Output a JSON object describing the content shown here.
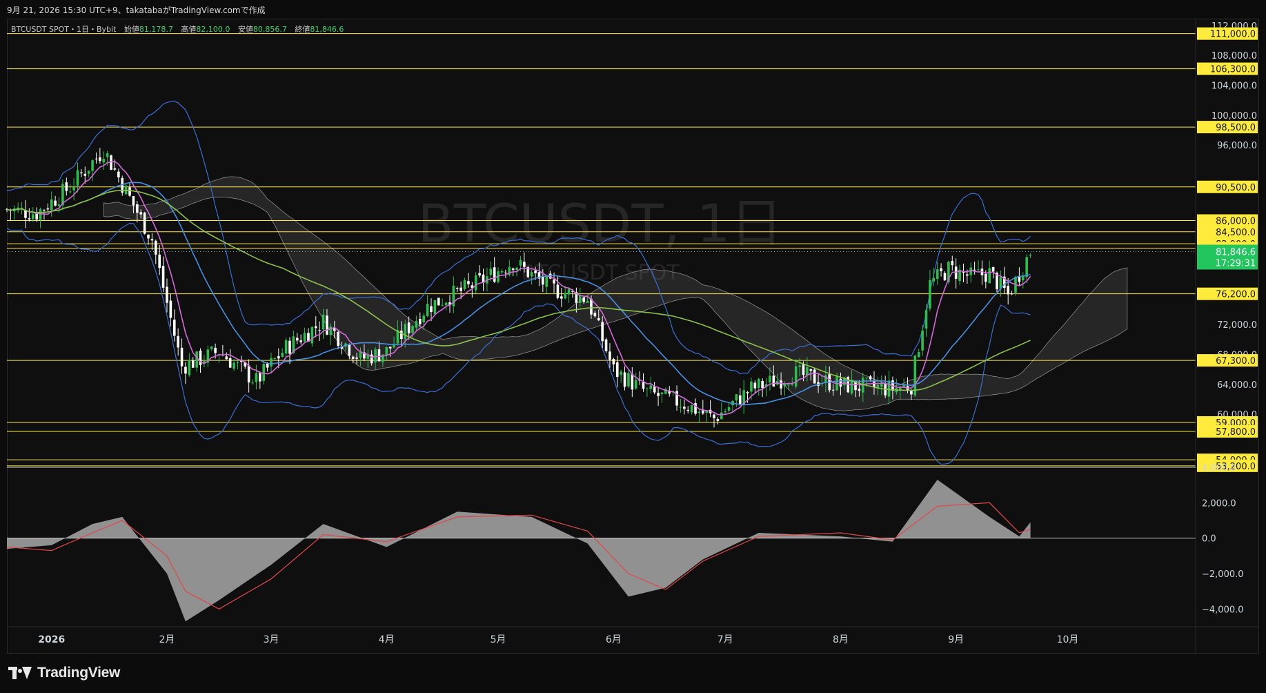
{
  "header": {
    "created_line": "9月 21, 2026 15:30 UTC+9、takatabaがTradingView.comで作成"
  },
  "legend": {
    "symbol": "BTCUSDT SPOT・1日・Bybit",
    "open_label": "始値",
    "open": "81,178.7",
    "high_label": "高値",
    "high": "82,100.0",
    "low_label": "安値",
    "low": "80,856.7",
    "close_label": "終値",
    "close": "81,846.6"
  },
  "watermark": {
    "title": "BTCUSDT, 1日",
    "subtitle": "BTCUSDT SPOT"
  },
  "colors": {
    "background": "#0f0f0f",
    "up": "#2ebd4f",
    "down": "#ffffff",
    "level_line": "#ffe94a",
    "level_tag": "#ffeb3b",
    "price_tag": "#22c55e",
    "bollinger": "#3b6fd4",
    "fast_ma": "#d46bd9",
    "mid_ma": "#4a90e2",
    "slow_ma": "#8bc34a",
    "cloud": "#6b6b6b",
    "macd_hist": "#a8a8a8",
    "macd_signal": "#e04848"
  },
  "price_axis": {
    "ticks": [
      "112,000.0",
      "108,000.0",
      "104,000.0",
      "100,000.0",
      "96,000.0",
      "72,000.0",
      "68,000.0",
      "64,000.0",
      "60,000.0"
    ],
    "level_tags": [
      "111,000.0",
      "106,300.0",
      "98,500.0",
      "90,500.0",
      "86,000.0",
      "84,500.0",
      "82,900.0",
      "82,300.0",
      "76,200.0",
      "67,300.0",
      "59,000.0",
      "57,800.0",
      "54,000.0",
      "53,200.0"
    ],
    "current_price": "81,846.6",
    "countdown": "17:29:31"
  },
  "macd_axis": {
    "ticks": [
      "4,000.0",
      "2,000.0",
      "0.0",
      "−2,000.0",
      "−4,000.0"
    ]
  },
  "time_axis": {
    "labels": [
      "2026",
      "2月",
      "3月",
      "4月",
      "5月",
      "6月",
      "7月",
      "8月",
      "9月",
      "10月"
    ]
  },
  "footer": {
    "brand": "TradingView"
  },
  "chart_data": {
    "type": "candlestick",
    "title": "BTCUSDT, 1日",
    "x_labels": [
      "2026",
      "2月",
      "3月",
      "4月",
      "5月",
      "6月",
      "7月",
      "8月",
      "9月",
      "10月"
    ],
    "ylim": [
      53000,
      113000
    ],
    "horizontal_levels": [
      111000,
      106300,
      98500,
      90500,
      86000,
      84500,
      82900,
      82300,
      76200,
      67300,
      59000,
      57800,
      54000,
      53200
    ],
    "close_path": [
      {
        "date": "2025-12-20",
        "close": 87500
      },
      {
        "date": "2025-12-28",
        "close": 87000
      },
      {
        "date": "2026-01-06",
        "close": 90500
      },
      {
        "date": "2026-01-15",
        "close": 95500
      },
      {
        "date": "2026-01-22",
        "close": 89000
      },
      {
        "date": "2026-01-28",
        "close": 83500
      },
      {
        "date": "2026-02-05",
        "close": 66500
      },
      {
        "date": "2026-02-15",
        "close": 68500
      },
      {
        "date": "2026-02-25",
        "close": 64500
      },
      {
        "date": "2026-03-05",
        "close": 69000
      },
      {
        "date": "2026-03-15",
        "close": 72500
      },
      {
        "date": "2026-03-25",
        "close": 67500
      },
      {
        "date": "2026-04-01",
        "close": 68500
      },
      {
        "date": "2026-04-12",
        "close": 74500
      },
      {
        "date": "2026-04-25",
        "close": 77500
      },
      {
        "date": "2026-05-05",
        "close": 80500
      },
      {
        "date": "2026-05-15",
        "close": 77000
      },
      {
        "date": "2026-05-25",
        "close": 75500
      },
      {
        "date": "2026-06-01",
        "close": 66000
      },
      {
        "date": "2026-06-10",
        "close": 63000
      },
      {
        "date": "2026-06-20",
        "close": 61500
      },
      {
        "date": "2026-06-28",
        "close": 59500
      },
      {
        "date": "2026-07-08",
        "close": 63500
      },
      {
        "date": "2026-07-20",
        "close": 65500
      },
      {
        "date": "2026-08-01",
        "close": 64000
      },
      {
        "date": "2026-08-15",
        "close": 63500
      },
      {
        "date": "2026-08-20",
        "close": 64000
      },
      {
        "date": "2026-08-25",
        "close": 77500
      },
      {
        "date": "2026-08-30",
        "close": 79500
      },
      {
        "date": "2026-09-05",
        "close": 78500
      },
      {
        "date": "2026-09-10",
        "close": 79000
      },
      {
        "date": "2026-09-15",
        "close": 76000
      },
      {
        "date": "2026-09-21",
        "close": 81846.6
      }
    ],
    "macd": {
      "ylim": [
        -5000,
        4000
      ],
      "points": [
        {
          "date": "2025-12-20",
          "hist": -600,
          "signal": -500
        },
        {
          "date": "2026-01-01",
          "hist": -400,
          "signal": -700
        },
        {
          "date": "2026-01-12",
          "hist": 800,
          "signal": 300
        },
        {
          "date": "2026-01-20",
          "hist": 1200,
          "signal": 1000
        },
        {
          "date": "2026-02-01",
          "hist": -2000,
          "signal": -1000
        },
        {
          "date": "2026-02-06",
          "hist": -4700,
          "signal": -3000
        },
        {
          "date": "2026-02-15",
          "hist": -3500,
          "signal": -4000
        },
        {
          "date": "2026-03-01",
          "hist": -1500,
          "signal": -2300
        },
        {
          "date": "2026-03-15",
          "hist": 800,
          "signal": 200
        },
        {
          "date": "2026-04-01",
          "hist": -500,
          "signal": -200
        },
        {
          "date": "2026-04-20",
          "hist": 1500,
          "signal": 1200
        },
        {
          "date": "2026-05-10",
          "hist": 1200,
          "signal": 1300
        },
        {
          "date": "2026-05-25",
          "hist": -300,
          "signal": 400
        },
        {
          "date": "2026-06-05",
          "hist": -3300,
          "signal": -2000
        },
        {
          "date": "2026-06-15",
          "hist": -2800,
          "signal": -2900
        },
        {
          "date": "2026-06-25",
          "hist": -1200,
          "signal": -1300
        },
        {
          "date": "2026-07-10",
          "hist": 300,
          "signal": 100
        },
        {
          "date": "2026-08-01",
          "hist": 100,
          "signal": 300
        },
        {
          "date": "2026-08-15",
          "hist": -200,
          "signal": -100
        },
        {
          "date": "2026-08-27",
          "hist": 3300,
          "signal": 1800
        },
        {
          "date": "2026-09-10",
          "hist": 1200,
          "signal": 2000
        },
        {
          "date": "2026-09-18",
          "hist": 100,
          "signal": 300
        },
        {
          "date": "2026-09-21",
          "hist": 900,
          "signal": 500
        }
      ]
    }
  }
}
